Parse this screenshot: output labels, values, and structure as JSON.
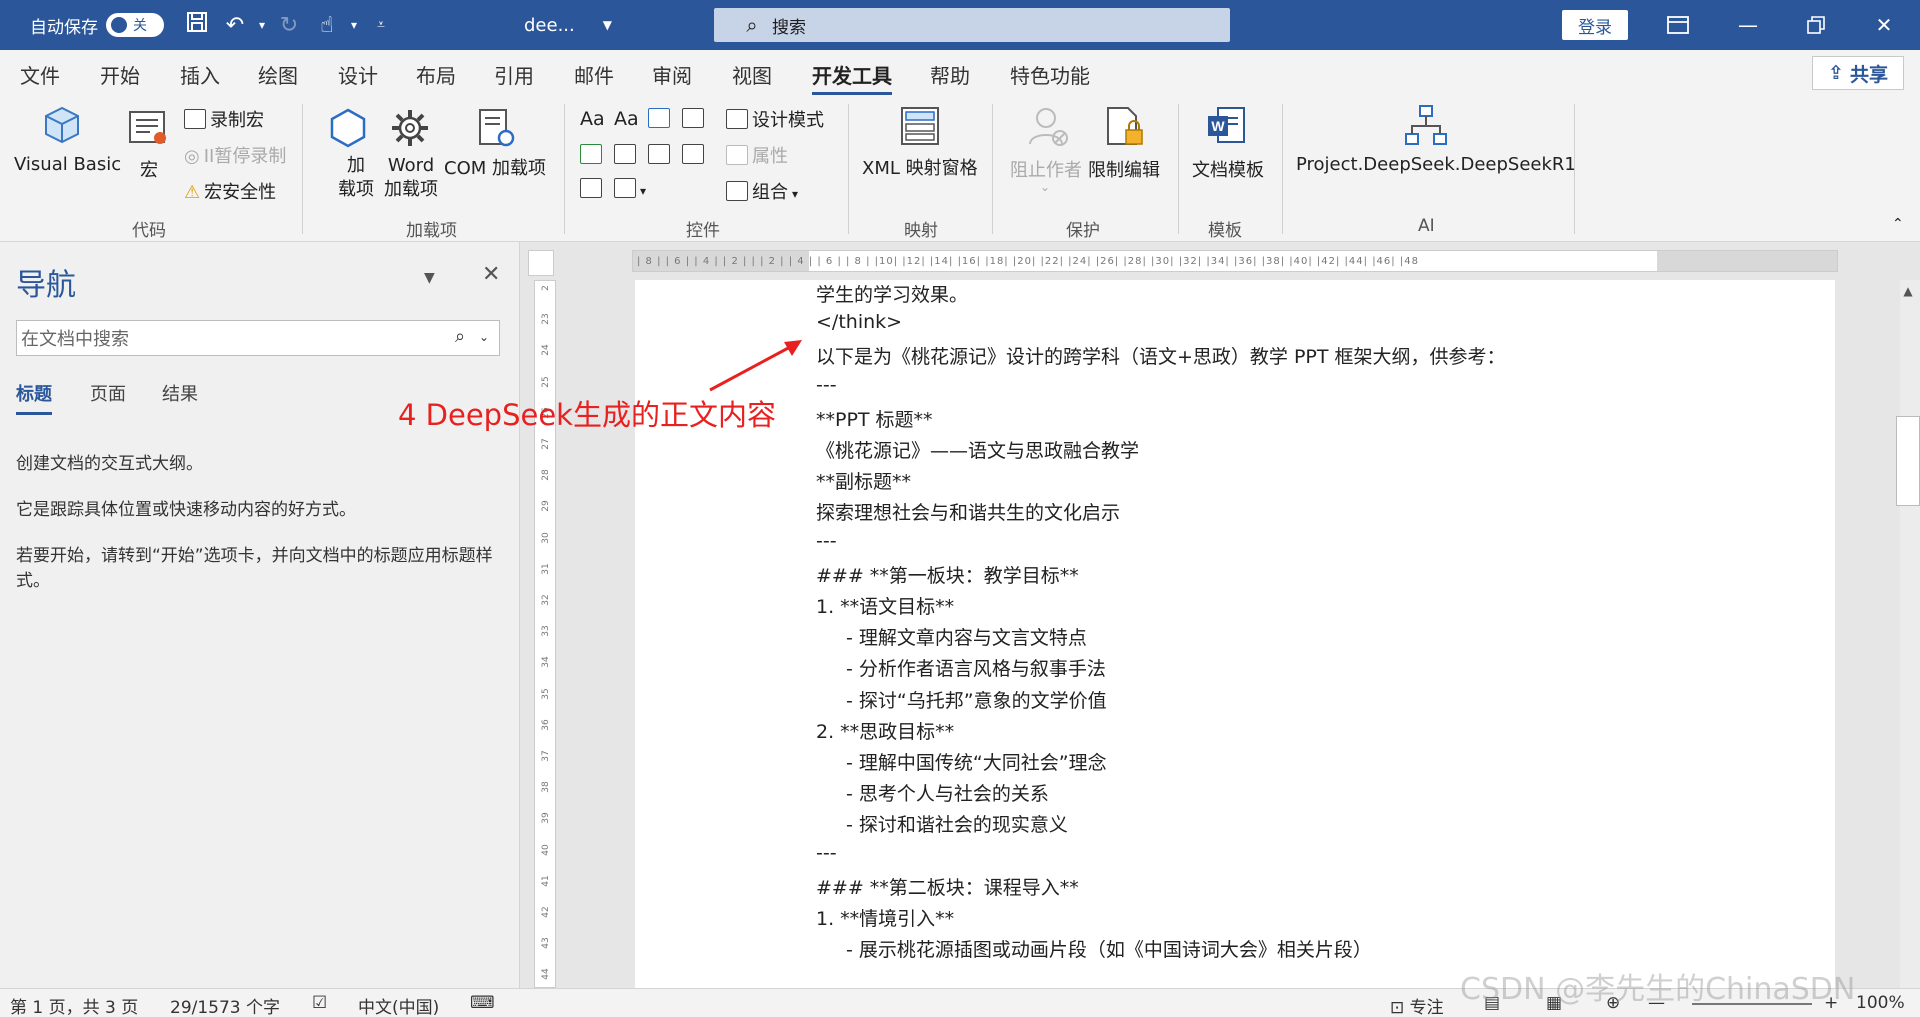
{
  "titlebar": {
    "autosave_label": "自动保存",
    "autosave_state": "关",
    "doc_title": "dee...",
    "search_placeholder": "搜索",
    "login_label": "登录"
  },
  "menu": {
    "tabs": [
      "文件",
      "开始",
      "插入",
      "绘图",
      "设计",
      "布局",
      "引用",
      "邮件",
      "审阅",
      "视图",
      "开发工具",
      "帮助",
      "特色功能"
    ],
    "active": "开发工具",
    "share_label": "共享"
  },
  "ribbon": {
    "code": {
      "label": "代码",
      "visual_basic": "Visual Basic",
      "macro": "宏",
      "record_macro": "录制宏",
      "pause_recording": "II暂停录制",
      "macro_security": "宏安全性"
    },
    "addins": {
      "label": "加载项",
      "addins_line1": "加",
      "addins_line2": "载项",
      "word_addins_line1": "Word",
      "word_addins_line2": "加载项",
      "com_addins": "COM 加载项"
    },
    "controls": {
      "label": "控件",
      "design_mode": "设计模式",
      "properties": "属性",
      "group": "组合"
    },
    "mapping": {
      "label": "映射",
      "xml_pane": "XML 映射窗格"
    },
    "protect": {
      "label": "保护",
      "block_authors": "阻止作者",
      "restrict_editing": "限制编辑"
    },
    "templates": {
      "label": "模板",
      "document_template": "文档模板"
    },
    "ai": {
      "label": "AI",
      "deepseek": "Project.DeepSeek.DeepSeekR1"
    }
  },
  "nav": {
    "title": "导航",
    "search_placeholder": "在文档中搜索",
    "tabs": [
      "标题",
      "页面",
      "结果"
    ],
    "text1": "创建文档的交互式大纲。",
    "text2": "它是跟踪具体位置或快速移动内容的好方式。",
    "text3": "若要开始，请转到“开始”选项卡，并向文档中的标题应用标题样式。"
  },
  "ruler": {
    "h_ticks": "| 8 |  | 6 |  | 4 |  | 2 |  |      | 2 |  | 4 |  | 6 |  | 8 |  |10|  |12|  |14|  |16|  |18|  |20|  |22|  |24|  |26|  |28|  |30|  |32|  |34|  |36|  |38|  |40|  |42|  |44|  |46|  |48",
    "v_ticks": [
      "2",
      "23",
      "24",
      "25",
      "26",
      "27",
      "28",
      "29",
      "30",
      "31",
      "32",
      "33",
      "34",
      "35",
      "36",
      "37",
      "38",
      "39",
      "40",
      "41",
      "42",
      "43",
      "44"
    ]
  },
  "document": {
    "lines": [
      {
        "text": "学生的学习效果。",
        "indent": false
      },
      {
        "text": "</think>",
        "indent": false
      },
      {
        "text": "以下是为《桃花源记》设计的跨学科（语文+思政）教学 PPT 框架大纲，供参考：",
        "indent": false
      },
      {
        "text": "---",
        "indent": false
      },
      {
        "text": "**PPT 标题**",
        "indent": false
      },
      {
        "text": "《桃花源记》——语文与思政融合教学",
        "indent": false
      },
      {
        "text": "**副标题**",
        "indent": false
      },
      {
        "text": "探索理想社会与和谐共生的文化启示",
        "indent": false
      },
      {
        "text": "---",
        "indent": false
      },
      {
        "text": "### **第一板块：教学目标**",
        "indent": false
      },
      {
        "text": "1. **语文目标**",
        "indent": false
      },
      {
        "text": "- 理解文章内容与文言文特点",
        "indent": true
      },
      {
        "text": "- 分析作者语言风格与叙事手法",
        "indent": true
      },
      {
        "text": "- 探讨“乌托邦”意象的文学价值",
        "indent": true
      },
      {
        "text": "2. **思政目标**",
        "indent": false
      },
      {
        "text": "- 理解中国传统“大同社会”理念",
        "indent": true
      },
      {
        "text": "- 思考个人与社会的关系",
        "indent": true
      },
      {
        "text": "- 探讨和谐社会的现实意义",
        "indent": true
      },
      {
        "text": "---",
        "indent": false
      },
      {
        "text": "### **第二板块：课程导入**",
        "indent": false
      },
      {
        "text": "1. **情境引入**",
        "indent": false
      },
      {
        "text": "- 展示桃花源插图或动画片段（如《中国诗词大会》相关片段）",
        "indent": true
      }
    ]
  },
  "annotation": {
    "text": "4 DeepSeek生成的正文内容",
    "color": "#e82020"
  },
  "status": {
    "page": "第 1 页，共 3 页",
    "words": "29/1573 个字",
    "language": "中文(中国)",
    "focus": "专注",
    "zoom": "100%"
  },
  "watermark": "CSDN @李先生的ChinaSDN",
  "colors": {
    "accent": "#2b579a",
    "annotation": "#e82020"
  }
}
